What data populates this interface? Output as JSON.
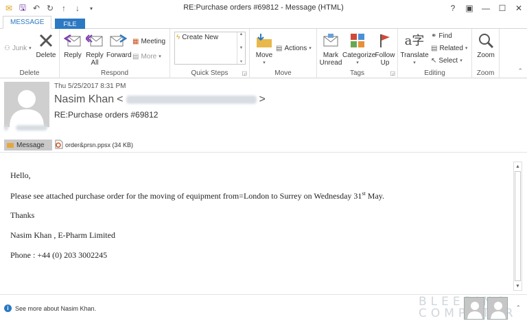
{
  "window": {
    "title": "RE:Purchase orders #69812 - Message (HTML)",
    "controls": [
      "?",
      "▣",
      "—",
      "☐",
      "✕"
    ]
  },
  "tabs": [
    {
      "label": "FILE",
      "active": false
    },
    {
      "label": "MESSAGE",
      "active": true
    }
  ],
  "ribbon": {
    "delete_group": {
      "junk": "Junk",
      "delete": "Delete",
      "label": "Delete"
    },
    "respond_group": {
      "reply": "Reply",
      "reply_all_1": "Reply",
      "reply_all_2": "All",
      "forward": "Forward",
      "meeting": "Meeting",
      "more": "More",
      "label": "Respond"
    },
    "quick_steps": {
      "create_new": "Create New",
      "label": "Quick Steps"
    },
    "move_group": {
      "move": "Move",
      "actions": "Actions",
      "label": "Move"
    },
    "tags_group": {
      "mark_unread_1": "Mark",
      "mark_unread_2": "Unread",
      "categorize": "Categorize",
      "follow_up_1": "Follow",
      "follow_up_2": "Up",
      "label": "Tags"
    },
    "editing_group": {
      "translate": "Translate",
      "find": "Find",
      "related": "Related",
      "select": "Select",
      "label": "Editing"
    },
    "zoom_group": {
      "zoom": "Zoom",
      "label": "Zoom"
    }
  },
  "header": {
    "date": "Thu 5/25/2017 8:31 PM",
    "sender": "Nasim Khan",
    "sender_open": "<",
    "sender_close": ">",
    "subject": "RE:Purchase orders #69812"
  },
  "attachments": {
    "message_label": "Message",
    "file": "order&prsn.ppsx (34 KB)"
  },
  "body": {
    "greeting": "Hello,",
    "line1_main": "Please see attached purchase order for the moving of equipment from=London to Surrey on Wednesday 31",
    "line1_sup": "st",
    "line1_end": " May.",
    "thanks": "Thanks",
    "signature": "Nasim Khan , E-Pharm Limited",
    "phone": "Phone : +44 (0) 203 3002245"
  },
  "footer": {
    "people_info": "See more about Nasim Khan.",
    "watermark_1": "BLEEPING",
    "watermark_2": "COMPUTER"
  },
  "colors": {
    "accent": "#2b79c2",
    "ribbon_border": "#d4d4d4"
  }
}
